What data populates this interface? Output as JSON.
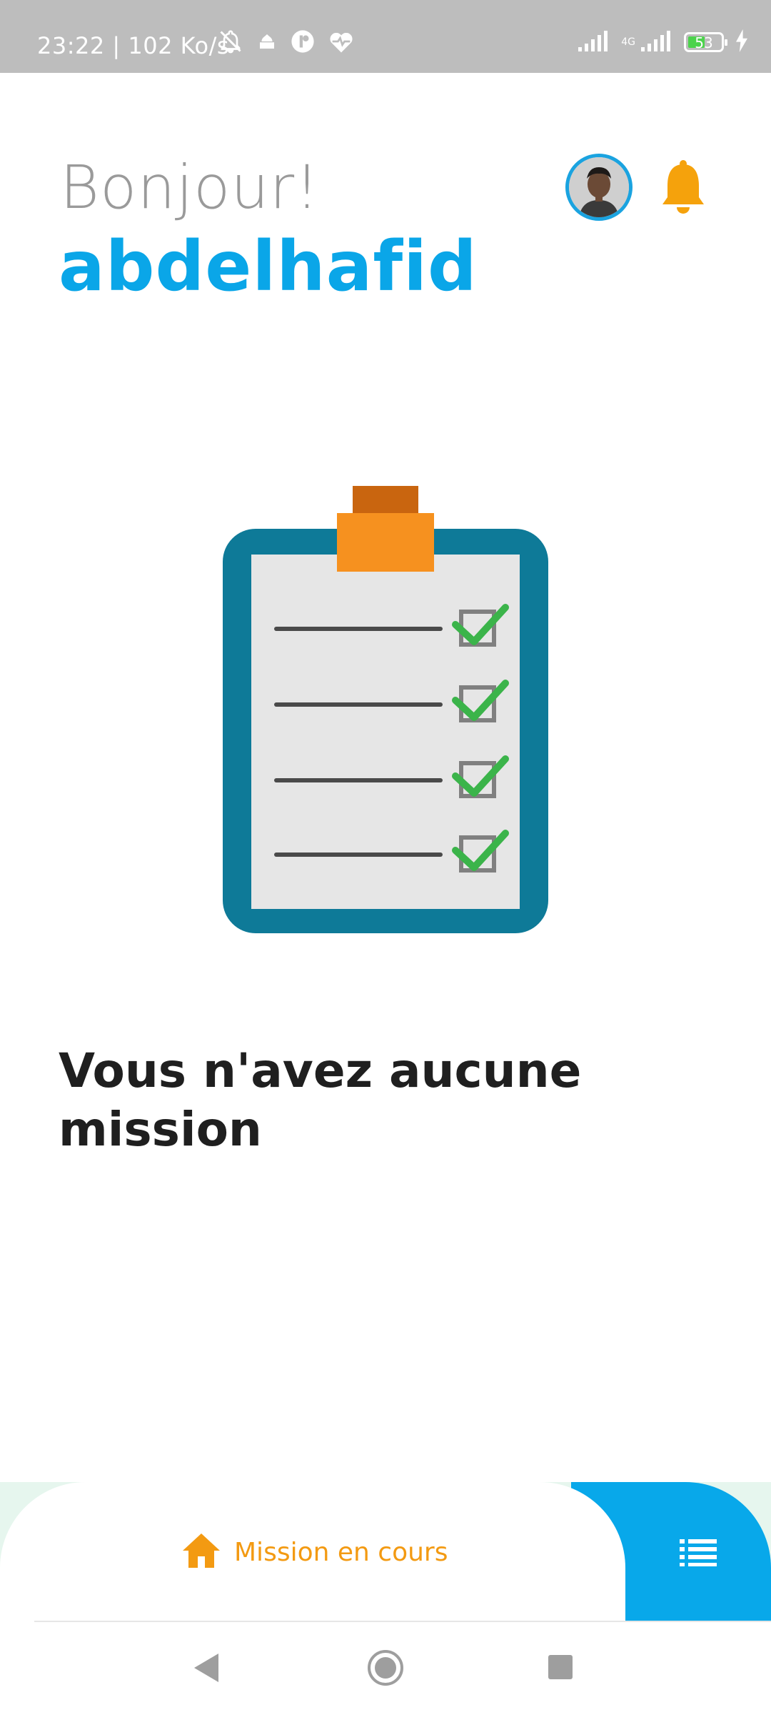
{
  "status_bar": {
    "text": "23:22 | 102 Ko/s",
    "network_label": "4G",
    "battery_level": "53",
    "battery_fraction": 0.53,
    "icons": [
      "bell-off-icon",
      "mosque-icon",
      "app-icon",
      "heart-pulse-icon",
      "signal-icon",
      "signal-4g-icon",
      "battery-icon",
      "charging-icon"
    ]
  },
  "header": {
    "greeting": "Bonjour!",
    "username": "abdelhafid",
    "icons": [
      "avatar",
      "bell-icon"
    ]
  },
  "main": {
    "illustration": "clipboard-checklist-icon",
    "checklist_items": 4,
    "empty_title": "Vous n'avez aucune mission"
  },
  "bottom_nav": {
    "home_label": "Mission en cours",
    "home_icon": "home-icon",
    "list_icon": "list-icon"
  },
  "system_nav": {
    "icons": [
      "back-icon",
      "home-circle-icon",
      "recents-icon"
    ]
  },
  "colors": {
    "accent_blue": "#0aa6e8",
    "accent_orange": "#f39a12",
    "clipboard_teal": "#0e7a98",
    "check_green": "#3bb44a",
    "status_bar": "#bdbdbd"
  }
}
